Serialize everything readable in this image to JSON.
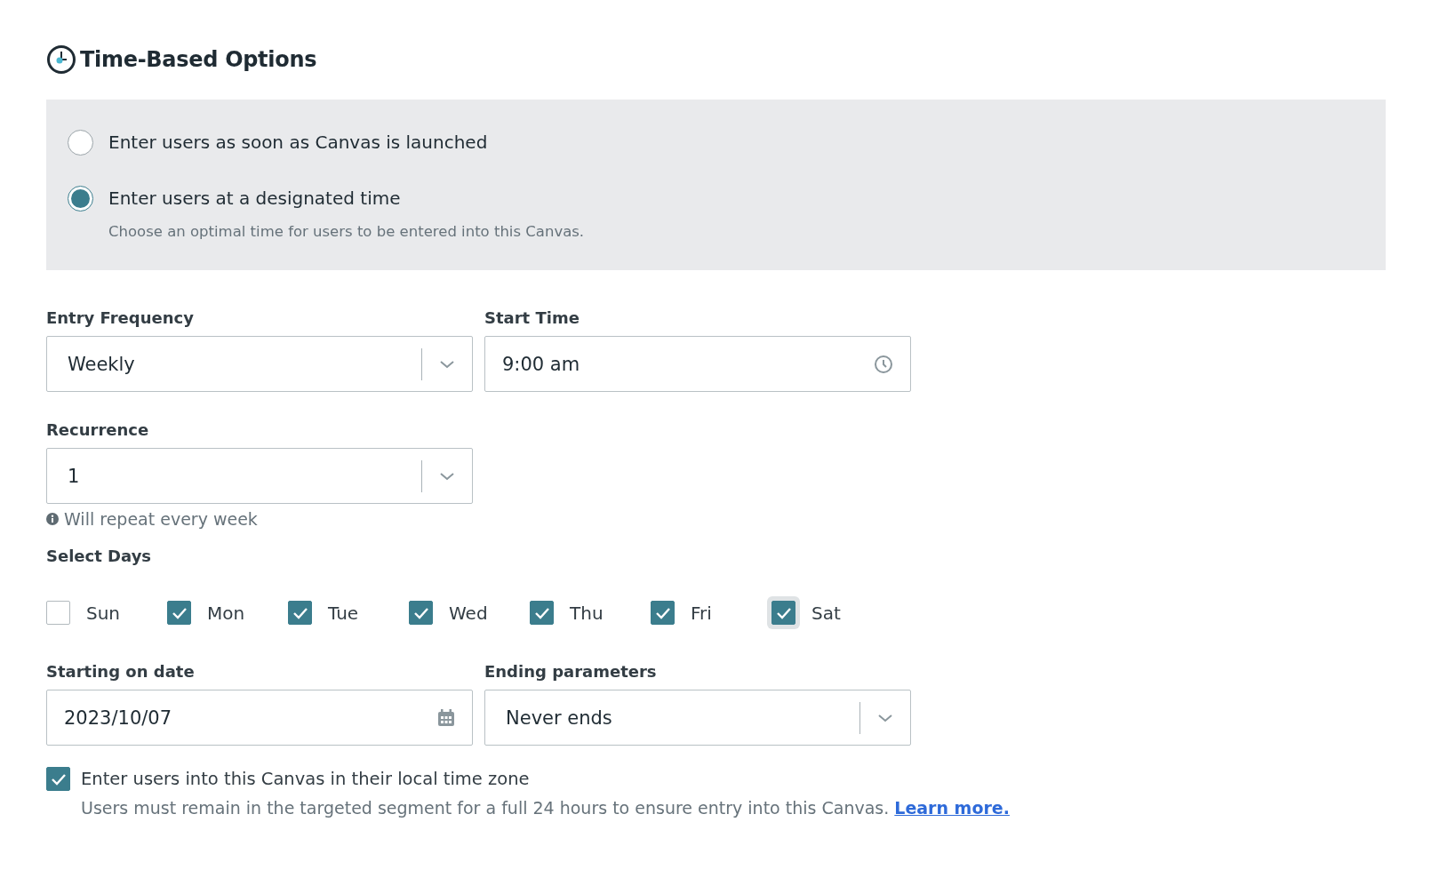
{
  "title": "Time-Based Options",
  "entry_options": [
    {
      "label": "Enter users as soon as Canvas is launched",
      "selected": false
    },
    {
      "label": "Enter users at a designated time",
      "selected": true,
      "description": "Choose an optimal time for users to be entered into this Canvas."
    }
  ],
  "entry_frequency": {
    "label": "Entry Frequency",
    "value": "Weekly"
  },
  "start_time": {
    "label": "Start Time",
    "value": "9:00 am"
  },
  "recurrence": {
    "label": "Recurrence",
    "value": "1",
    "hint": "Will repeat every week"
  },
  "select_days": {
    "label": "Select Days",
    "days": [
      {
        "label": "Sun",
        "checked": false,
        "focused": false
      },
      {
        "label": "Mon",
        "checked": true,
        "focused": false
      },
      {
        "label": "Tue",
        "checked": true,
        "focused": false
      },
      {
        "label": "Wed",
        "checked": true,
        "focused": false
      },
      {
        "label": "Thu",
        "checked": true,
        "focused": false
      },
      {
        "label": "Fri",
        "checked": true,
        "focused": false
      },
      {
        "label": "Sat",
        "checked": true,
        "focused": true
      }
    ]
  },
  "starting_on_date": {
    "label": "Starting on date",
    "value": "2023/10/07"
  },
  "ending_parameters": {
    "label": "Ending parameters",
    "value": "Never ends"
  },
  "local_time_zone": {
    "label": "Enter users into this Canvas in their local time zone",
    "checked": true,
    "note": "Users must remain in the targeted segment for a full 24 hours to ensure entry into this Canvas.",
    "link": "Learn more."
  }
}
